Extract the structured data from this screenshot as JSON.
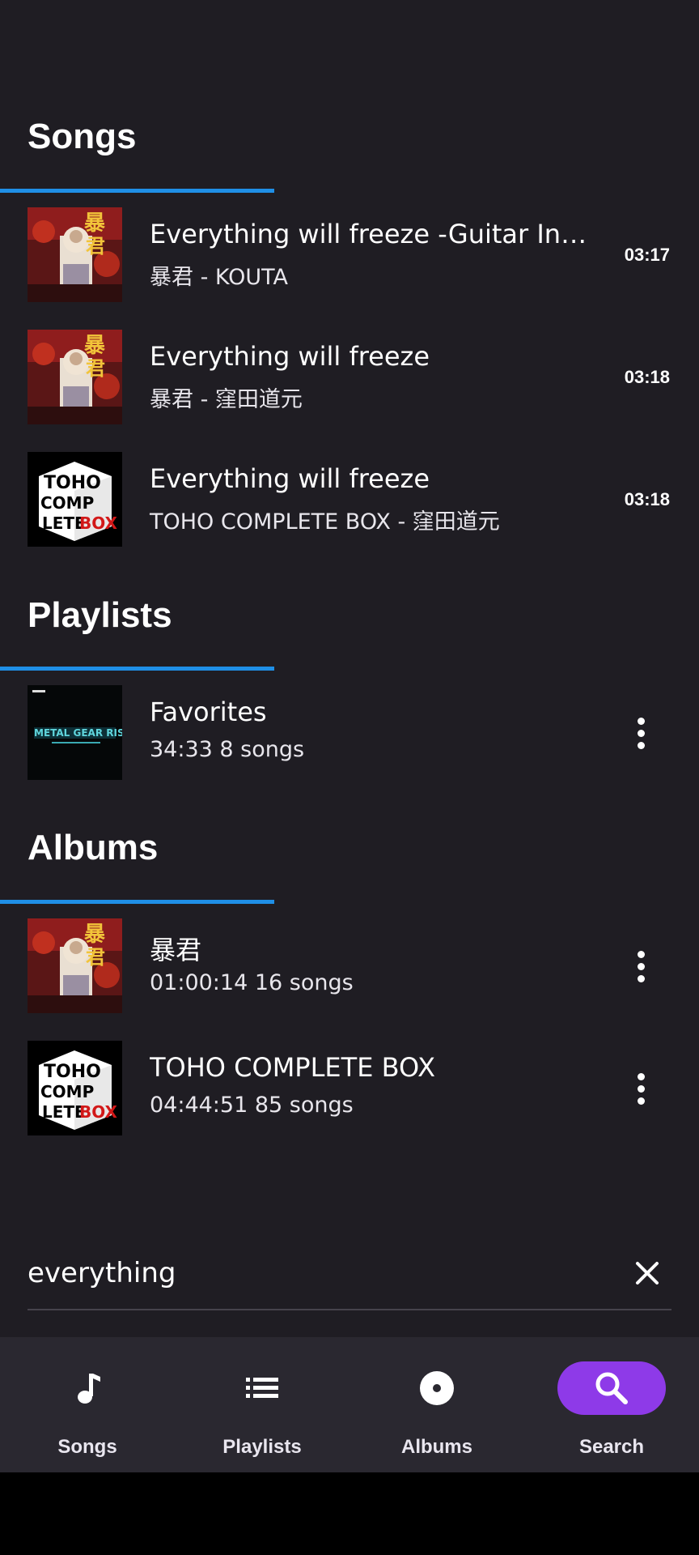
{
  "sections": {
    "songs_title": "Songs",
    "playlists_title": "Playlists",
    "albums_title": "Albums"
  },
  "songs": [
    {
      "title": "Everything will freeze -Guitar Instrumental-",
      "subtitle": "暴君 - KOUTA",
      "duration": "03:17",
      "art": "bokun-album-art"
    },
    {
      "title": "Everything will freeze",
      "subtitle": "暴君 - 窪田道元",
      "duration": "03:18",
      "art": "bokun-album-art"
    },
    {
      "title": "Everything will freeze",
      "subtitle": "TOHO COMPLETE BOX - 窪田道元",
      "duration": "03:18",
      "art": "toho-complete-box-art"
    }
  ],
  "playlists": [
    {
      "title": "Favorites",
      "subtitle": "34:33  8 songs",
      "art": "metal-gear-rising-art"
    }
  ],
  "albums": [
    {
      "title": "暴君",
      "subtitle": "01:00:14  16 songs",
      "art": "bokun-album-art"
    },
    {
      "title": "TOHO COMPLETE BOX",
      "subtitle": "04:44:51  85 songs",
      "art": "toho-complete-box-art"
    }
  ],
  "search": {
    "value": "everything"
  },
  "nav": [
    {
      "label": "Songs",
      "icon": "music-note-icon",
      "active": false
    },
    {
      "label": "Playlists",
      "icon": "list-icon",
      "active": false
    },
    {
      "label": "Albums",
      "icon": "disc-icon",
      "active": false
    },
    {
      "label": "Search",
      "icon": "search-icon",
      "active": true
    }
  ],
  "colors": {
    "background": "#1f1d23",
    "accent_underline": "#1f8fe6",
    "nav_active": "#8e3ae8",
    "nav_background": "#2a2830"
  }
}
